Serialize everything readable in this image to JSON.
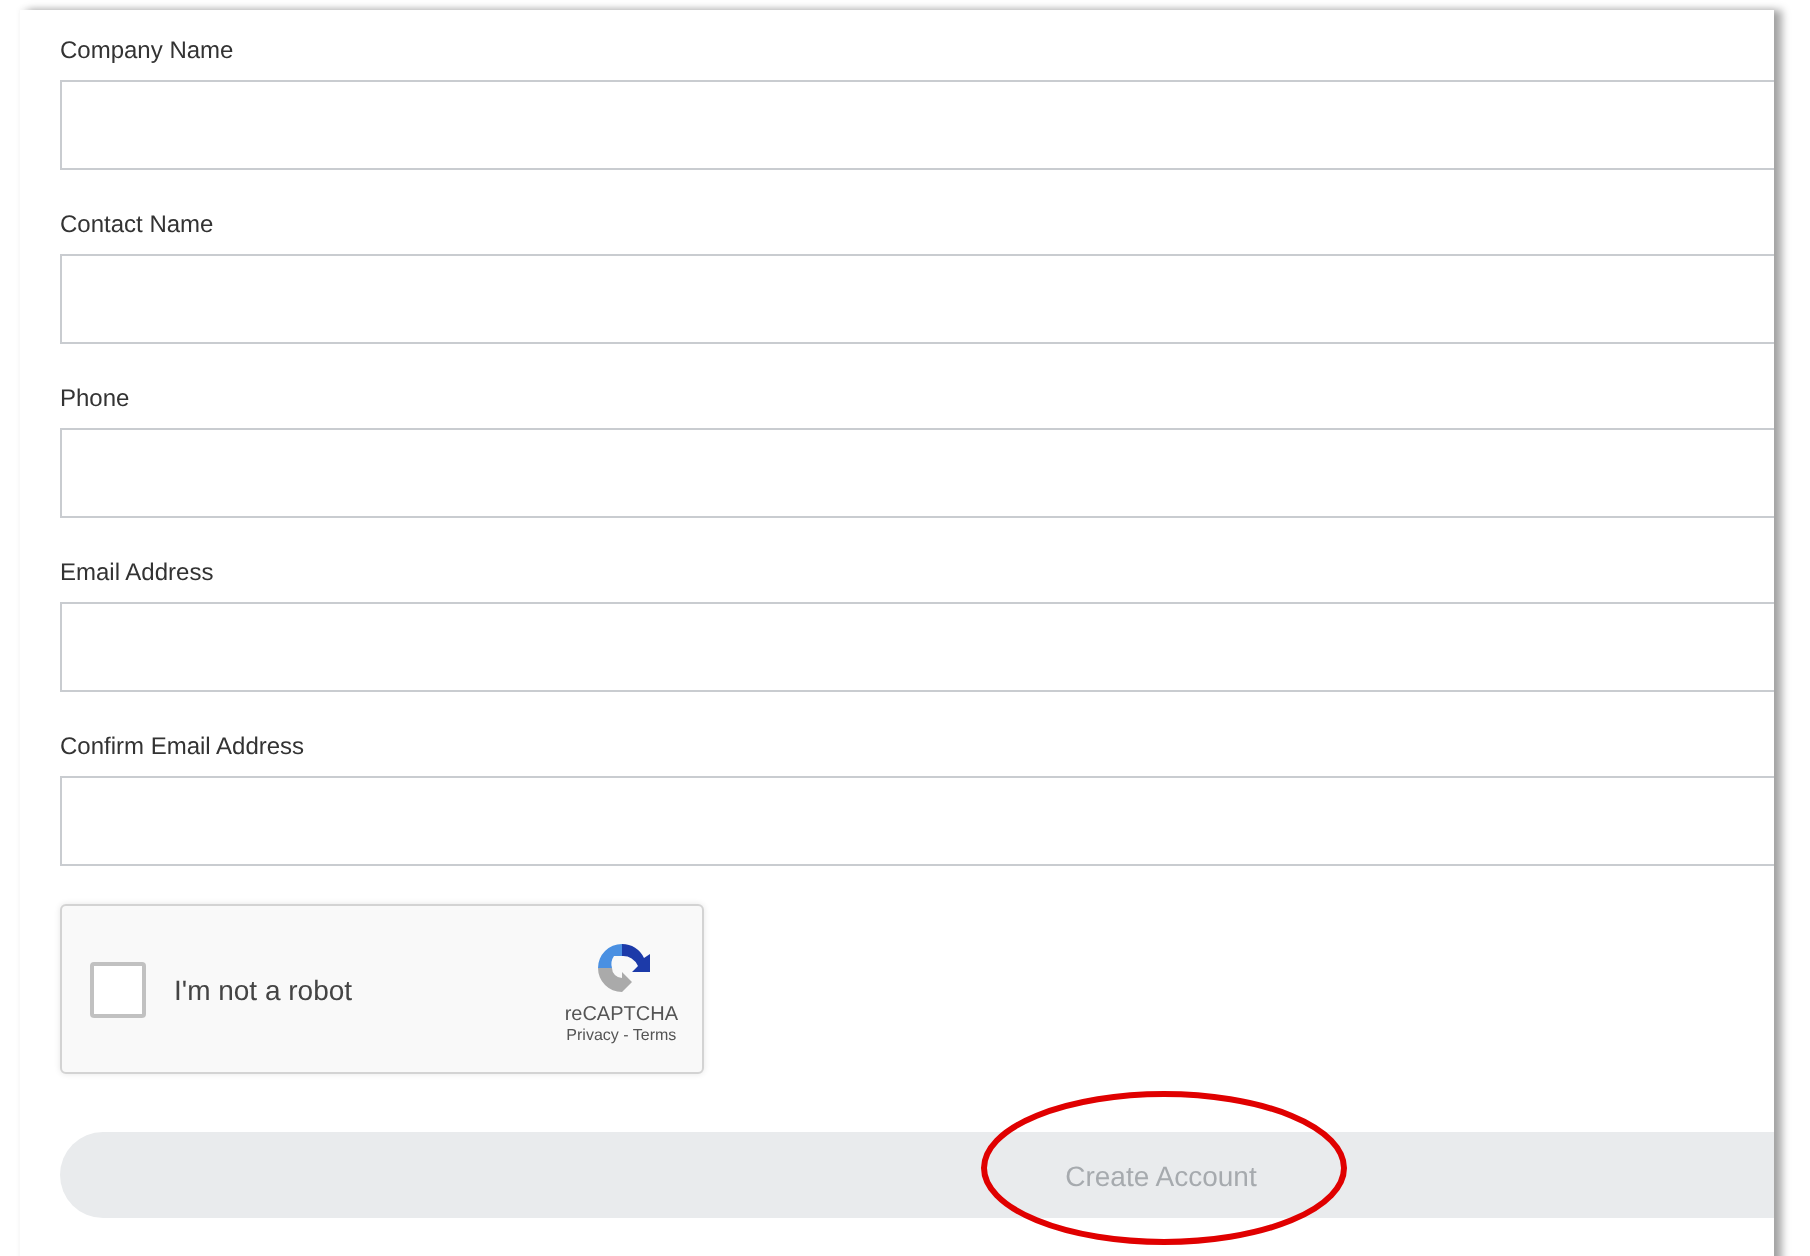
{
  "fields": [
    {
      "label": "Company Name"
    },
    {
      "label": "Contact Name"
    },
    {
      "label": "Phone"
    },
    {
      "label": "Email Address"
    },
    {
      "label": "Confirm Email Address"
    }
  ],
  "captcha": {
    "label": "I'm not a robot",
    "checked": false,
    "brand": "reCAPTCHA",
    "links": "Privacy - Terms"
  },
  "submit": {
    "label": "Create Account",
    "disabled": true,
    "highlighted": true
  }
}
